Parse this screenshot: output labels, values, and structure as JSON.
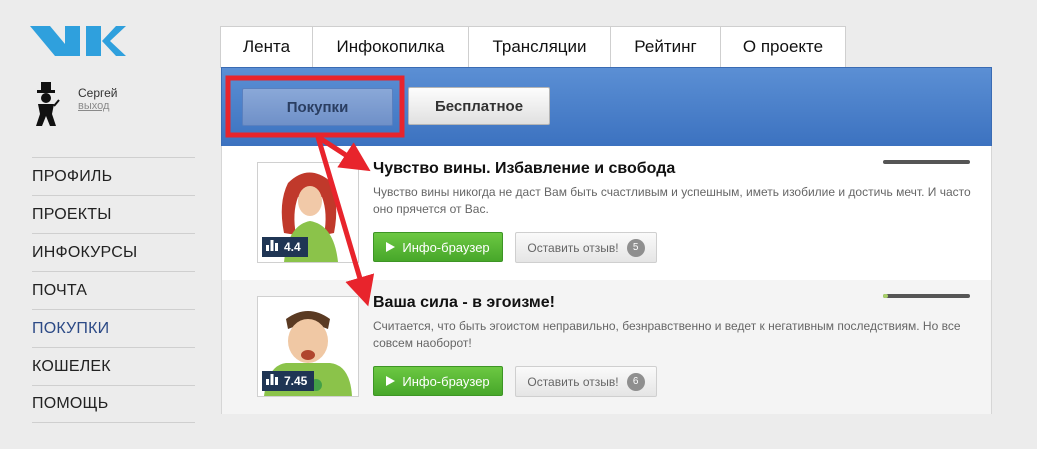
{
  "user": {
    "name": "Сергей",
    "logout": "выход"
  },
  "side_nav": {
    "items": [
      {
        "label": "ПРОФИЛЬ"
      },
      {
        "label": "ПРОЕКТЫ"
      },
      {
        "label": "ИНФОКУРСЫ"
      },
      {
        "label": "ПОЧТА"
      },
      {
        "label": "ПОКУПКИ",
        "active": true
      },
      {
        "label": "КОШЕЛЕК"
      },
      {
        "label": "ПОМОЩЬ"
      }
    ]
  },
  "tabs": [
    {
      "label": "Лента"
    },
    {
      "label": "Инфокопилка"
    },
    {
      "label": "Трансляции"
    },
    {
      "label": "Рейтинг"
    },
    {
      "label": "О проекте"
    }
  ],
  "filter": {
    "purchases": "Покупки",
    "free": "Бесплатное"
  },
  "products": [
    {
      "title": "Чувство вины. Избавление и свобода",
      "description": "Чувство вины никогда не даст Вам быть счастливым и успешным, иметь изобилие и достичь мечт. И часто оно прячется от Вас.",
      "rating": "4.4",
      "progress": 0.0,
      "browser_button": "Инфо-браузер",
      "review_button": "Оставить отзыв!",
      "review_count": "5"
    },
    {
      "title": "Ваша сила - в эгоизме!",
      "description": "Считается, что быть эгоистом неправильно, безнравственно и ведет к негативным последствиям. Но все совсем наоборот!",
      "rating": "7.45",
      "progress": 0.06,
      "browser_button": "Инфо-браузер",
      "review_button": "Оставить отзыв!",
      "review_count": "6"
    }
  ],
  "colors": {
    "accent": "#3c72c0",
    "annotation": "#e8242c",
    "green": "#52b030"
  },
  "icons": {
    "logo": "ik-logo",
    "avatar": "gentleman-avatar",
    "rating": "bar-chart-icon",
    "play": "play-icon"
  }
}
